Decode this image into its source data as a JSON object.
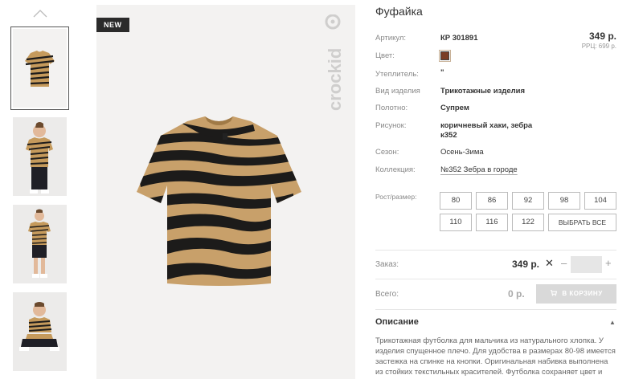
{
  "gallery": {
    "up_icon": "chevron-up-icon",
    "thumbnails": [
      {
        "alt": "shirt-flat"
      },
      {
        "alt": "boy-front"
      },
      {
        "alt": "boy-full"
      },
      {
        "alt": "boy-sitting"
      }
    ],
    "badge": "NEW",
    "brand_icon": "crockid-logo"
  },
  "product": {
    "title": "Фуфайка",
    "price": "349 р.",
    "rrp": "РРЦ: 699 р.",
    "color_hex": "#7a3d26",
    "rows": {
      "article": {
        "label": "Артикул:",
        "value": "КР 301891"
      },
      "color": {
        "label": "Цвет:"
      },
      "insulation": {
        "label": "Утеплитель:",
        "value": "\""
      },
      "type": {
        "label": "Вид изделия",
        "value": "Трикотажные изделия"
      },
      "fabric": {
        "label": "Полотно:",
        "value": "Супрем"
      },
      "pattern": {
        "label": "Рисунок:",
        "value_line1": "коричневый хаки, зебра",
        "value_line2": "к352"
      },
      "season": {
        "label": "Сезон:",
        "value": "Осень-Зима"
      },
      "collection": {
        "label": "Коллекция:",
        "value": "№352 Зебра в городе"
      }
    },
    "sizes": {
      "label": "Рост/размер:",
      "items": [
        "80",
        "86",
        "92",
        "98",
        "104",
        "110",
        "116",
        "122"
      ],
      "select_all": "ВЫБРАТЬ ВСЕ"
    }
  },
  "order": {
    "label": "Заказ:",
    "price": "349 р.",
    "times": "✕",
    "minus": "–",
    "plus": "+",
    "quantity": ""
  },
  "total": {
    "label": "Всего:",
    "value": "0 р.",
    "cart_button": "В КОРЗИНУ",
    "cart_icon": "cart-icon"
  },
  "description": {
    "title": "Описание",
    "text": "Трикотажная футболка для мальчика из натурального хлопка. У изделия спущенное плечо. Для удобства в размерах 80-98 имеется застежка на спинке на кнопки. Оригинальная набивка выполнена из стойких текстильных красителей. Футболка сохраняет цвет и форму после многократных стирок."
  }
}
